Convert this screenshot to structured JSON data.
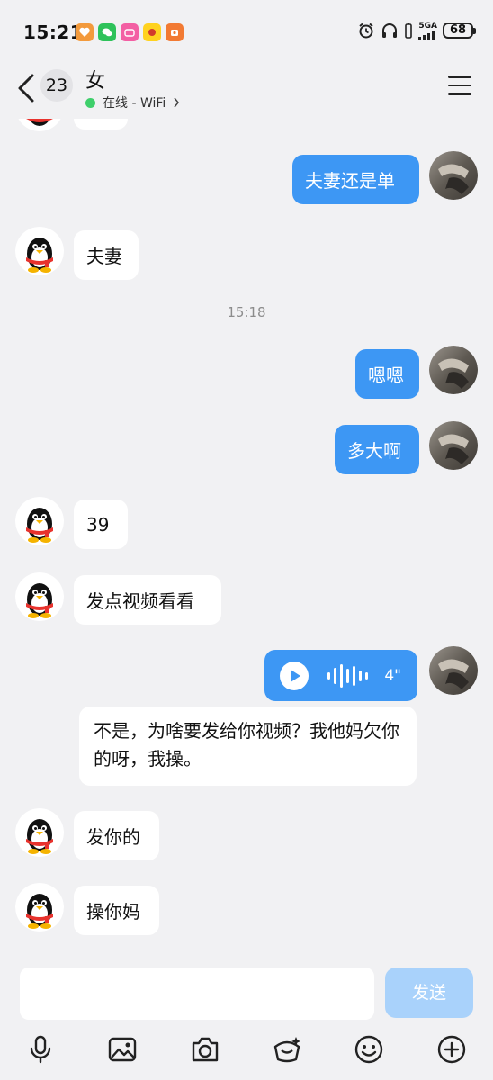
{
  "status": {
    "time": "15:21",
    "network": "5GA",
    "battery": "68"
  },
  "header": {
    "unread_count": "23",
    "title": "女",
    "presence": "在线 - WiFi"
  },
  "messages": {
    "m1": "夫妻还是单",
    "m2": "夫妻",
    "time1": "15:18",
    "m3": "嗯嗯",
    "m4": "多大啊",
    "m5": "39",
    "m6": "发点视频看看",
    "voice_duration": "4\"",
    "transcript": "不是，为啥要发给你视频？我他妈欠你的呀，我操。",
    "m8": "发你的",
    "m9": "操你妈"
  },
  "input": {
    "placeholder": "",
    "send_label": "发送"
  },
  "toolbar": {
    "icons": [
      "microphone-icon",
      "image-icon",
      "camera-icon",
      "red-packet-icon",
      "emoji-icon",
      "plus-icon"
    ]
  },
  "colors": {
    "outgoing_bubble": "#3d97f4",
    "incoming_bubble": "#ffffff",
    "background": "#f1f1f3",
    "send_disabled": "#a9d2fb",
    "online_dot": "#3ecf6b"
  }
}
